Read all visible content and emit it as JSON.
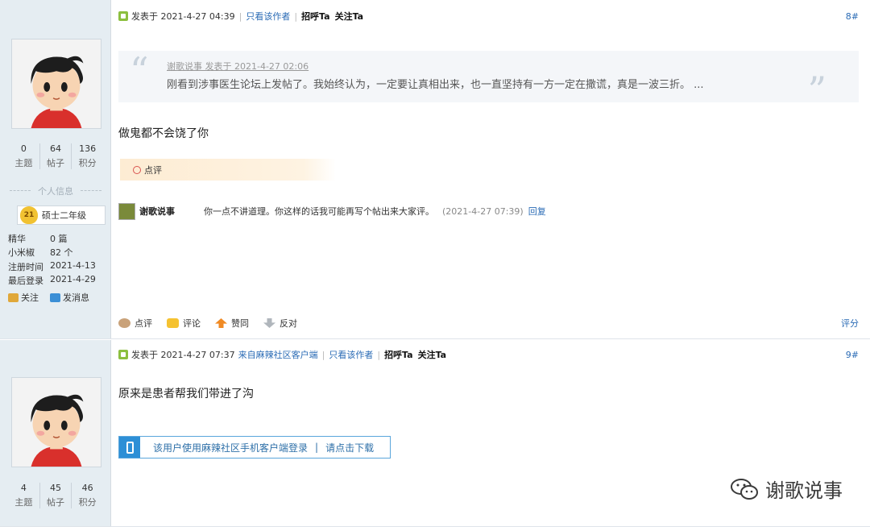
{
  "posts": [
    {
      "floor": "8#",
      "author_short": "",
      "stats": [
        {
          "num": "0",
          "label": "主题"
        },
        {
          "num": "64",
          "label": "帖子"
        },
        {
          "num": "136",
          "label": "积分"
        }
      ],
      "info_title": "个人信息",
      "rank": {
        "badge": "21",
        "text": "硕士二年级"
      },
      "kv": [
        {
          "k": "精华",
          "v": "0 篇"
        },
        {
          "k": "小米椒",
          "v": "82 个"
        },
        {
          "k": "注册时间",
          "v": "2021-4-13"
        },
        {
          "k": "最后登录",
          "v": "2021-4-29"
        }
      ],
      "side_actions": {
        "follow": "关注",
        "message": "发消息"
      },
      "header": {
        "time": "发表于 2021-4-27 04:39",
        "only_author": "只看该作者",
        "greet": "招呼Ta",
        "follow": "关注Ta"
      },
      "quote": {
        "by": "谢歌说事 发表于 2021-4-27 02:06",
        "text": "刚看到涉事医生论坛上发帖了。我始终认为，一定要让真相出来，也一直坚持有一方一定在撒谎，真是一波三折。 ..."
      },
      "body": "做鬼都不会饶了你",
      "rate_tag": "点评",
      "comment": {
        "name": "谢歌说事",
        "text": "你一点不讲道理。你这样的话我可能再写个帖出来大家评。",
        "time": "(2021-4-27 07:39)",
        "reply": "回复"
      },
      "actions": {
        "rate_comment": "点评",
        "review": "评论",
        "upvote": "赞同",
        "oppose": "反对",
        "score": "评分"
      }
    },
    {
      "floor": "9#",
      "author_short": "",
      "stats": [
        {
          "num": "4",
          "label": "主题"
        },
        {
          "num": "45",
          "label": "帖子"
        },
        {
          "num": "46",
          "label": "积分"
        }
      ],
      "header": {
        "time": "发表于 2021-4-27 07:37",
        "source": "来自麻辣社区客户端",
        "only_author": "只看该作者",
        "greet": "招呼Ta",
        "follow": "关注Ta"
      },
      "body": "原来是患者帮我们带进了沟",
      "app_banner": {
        "text": "该用户使用麻辣社区手机客户端登录",
        "bar": "|",
        "link": "请点击下载"
      }
    }
  ],
  "watermark": {
    "text": "谢歌说事",
    "icon": "wechat-icon"
  },
  "colors": {
    "link": "#2a6bb5",
    "sidebar_bg": "#e5edf2",
    "rate_tag_bg": "#fdecd3",
    "banner_blue": "#2d8fd6"
  }
}
